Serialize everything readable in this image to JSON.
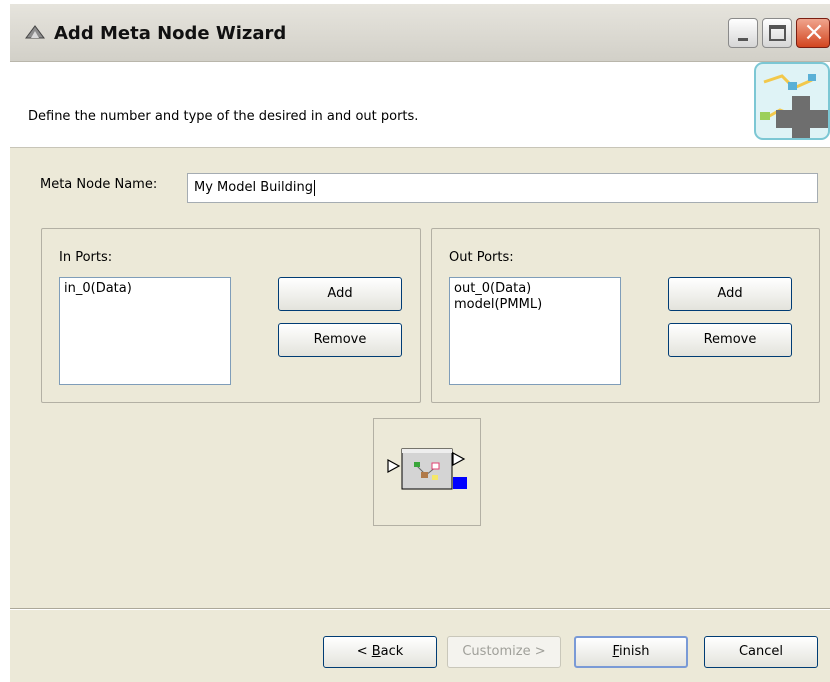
{
  "window": {
    "title": "Add Meta Node Wizard",
    "icon": "knime-wizard-icon"
  },
  "title_buttons": {
    "minimize_icon": "minimize-icon",
    "maximize_icon": "maximize-icon",
    "close_icon": "close-icon",
    "close_glyph": "×"
  },
  "header": {
    "description": "Define the number and type of the desired in and out ports.",
    "image": "meta-node-wizard-banner"
  },
  "meta_node": {
    "label": "Meta Node Name:",
    "value": "My Model Building"
  },
  "in_ports": {
    "title": "In Ports:",
    "items": [
      "in_0(Data)"
    ],
    "add_label": "Add",
    "remove_label": "Remove"
  },
  "out_ports": {
    "title": "Out Ports:",
    "items": [
      "out_0(Data)",
      "model(PMML)"
    ],
    "add_label": "Add",
    "remove_label": "Remove"
  },
  "preview": {
    "icon": "meta-node-preview-icon"
  },
  "footer": {
    "back_prefix": "< ",
    "back_mnemonic": "B",
    "back_rest": "ack",
    "customize_label": "Customize >",
    "finish_mnemonic": "F",
    "finish_rest": "inish",
    "cancel_label": "Cancel"
  },
  "colors": {
    "dialog_bg": "#ece9d8",
    "button_border": "#003c74",
    "close_button": "#d2451f",
    "port_data": "#000000",
    "port_model": "#0000ff"
  }
}
